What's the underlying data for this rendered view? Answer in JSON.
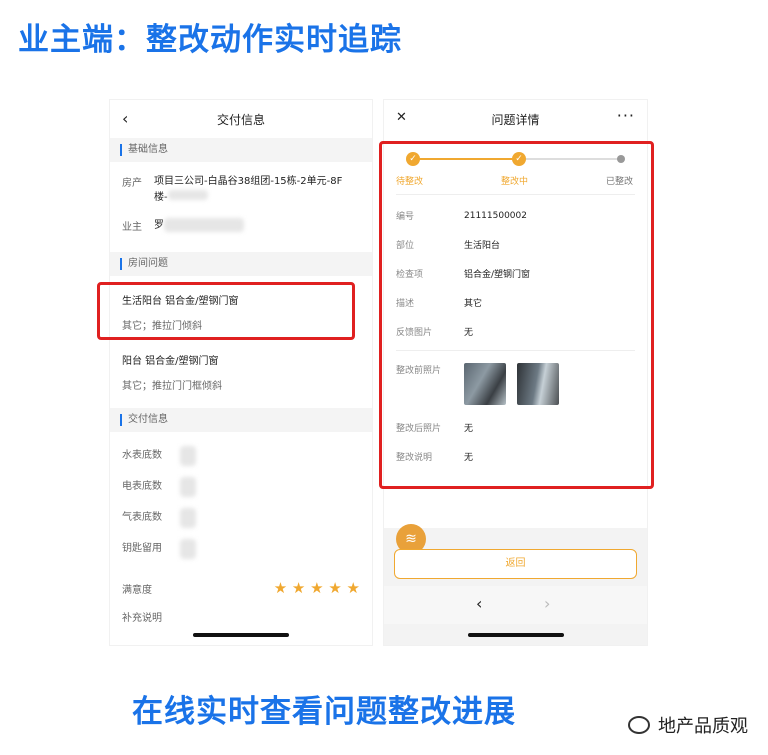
{
  "headline": "业主端：整改动作实时追踪",
  "subline": "在线实时查看问题整改进展",
  "watermark": "地产品质观",
  "left": {
    "title": "交付信息",
    "back_icon": "‹",
    "section_basic": "基础信息",
    "house_label": "房产",
    "house_value": "项目三公司-白晶谷38组团-15栋-2单元-8F",
    "house_value2": "楼-",
    "owner_label": "业主",
    "owner_value": "罗",
    "section_issues": "房间问题",
    "issue1_title": "生活阳台  铝合金/塑钢门窗",
    "issue1_sub": "其它；推拉门倾斜",
    "issue2_title": "阳台  铝合金/塑钢门窗",
    "issue2_sub": "其它；推拉门门框倾斜",
    "section_delivery": "交付信息",
    "water_label": "水表底数",
    "elec_label": "电表底数",
    "gas_label": "气表底数",
    "key_label": "钥匙留用",
    "satisfaction_label": "满意度",
    "stars": "★ ★ ★ ★ ★",
    "rating": 5,
    "note_label": "补充说明"
  },
  "right": {
    "title": "问题详情",
    "close_icon": "✕",
    "more_icon": "···",
    "step1": "待整改",
    "step2": "整改中",
    "step3": "已整改",
    "check": "✓",
    "code_label": "编号",
    "code_value": "21111500002",
    "part_label": "部位",
    "part_value": "生活阳台",
    "item_label": "检查项",
    "item_value": "铝合金/塑钢门窗",
    "desc_label": "描述",
    "desc_value": "其它",
    "feedback_label": "反馈图片",
    "feedback_value": "无",
    "before_label": "整改前照片",
    "after_label": "整改后照片",
    "after_value": "无",
    "note_label": "整改说明",
    "note_value": "无",
    "back_button": "返回",
    "fab_icon": "layers-icon",
    "prev": "‹",
    "next": "›"
  },
  "colors": {
    "accent": "#f0a830",
    "highlight_box": "#e02020",
    "headline": "#1a73e8"
  }
}
